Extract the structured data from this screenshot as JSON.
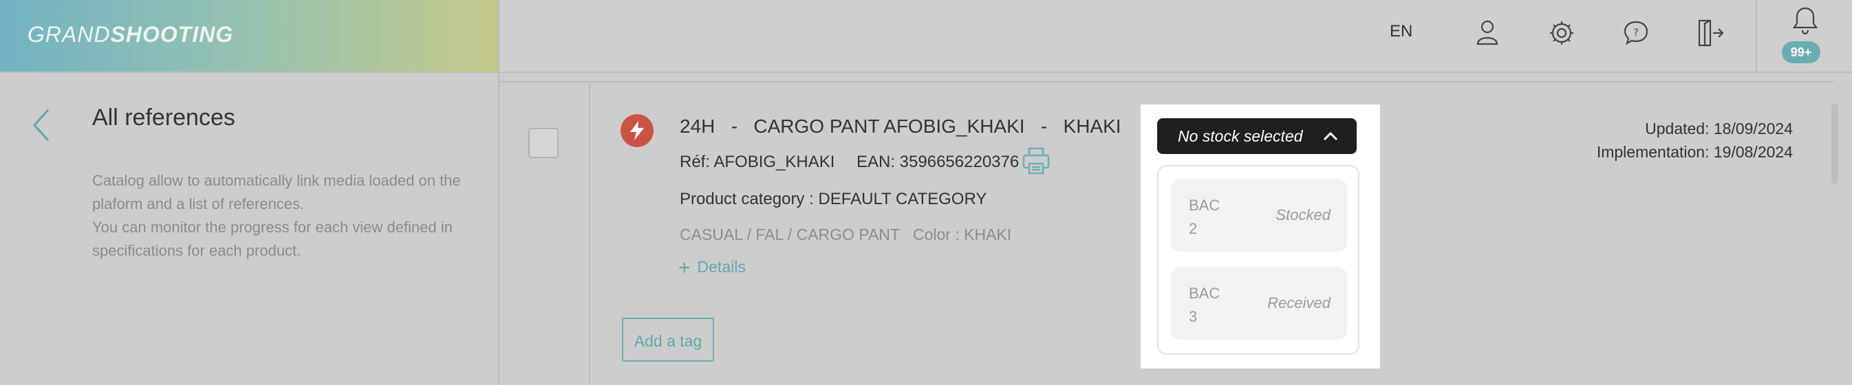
{
  "header": {
    "logo_light": "GRAND",
    "logo_bold": "SHOOTING",
    "language": "EN",
    "notifications_badge": "99+"
  },
  "left_panel": {
    "title": "All references",
    "description_line1": "Catalog allow to automatically link media loaded on the plaform and a list of references.",
    "description_line2": "You can monitor the progress for each view defined in specifications for each product."
  },
  "product": {
    "title": "24H   -   CARGO PANT AFOBIG_KHAKI   -   KHAKI",
    "ref": "Réf: AFOBIG_KHAKI",
    "ean": "EAN: 3596656220376",
    "category": "Product category : DEFAULT CATEGORY",
    "path": "CASUAL / FAL / CARGO PANT",
    "color": "Color : KHAKI",
    "details_label": "Details",
    "add_tag_label": "Add a tag",
    "updated": "Updated: 18/09/2024",
    "implementation": "Implementation: 19/08/2024"
  },
  "stock_dropdown": {
    "button_label": "No stock selected",
    "items": [
      {
        "bac": "BAC 2",
        "status": "Stocked"
      },
      {
        "bac": "BAC 3",
        "status": "Received"
      }
    ]
  }
}
